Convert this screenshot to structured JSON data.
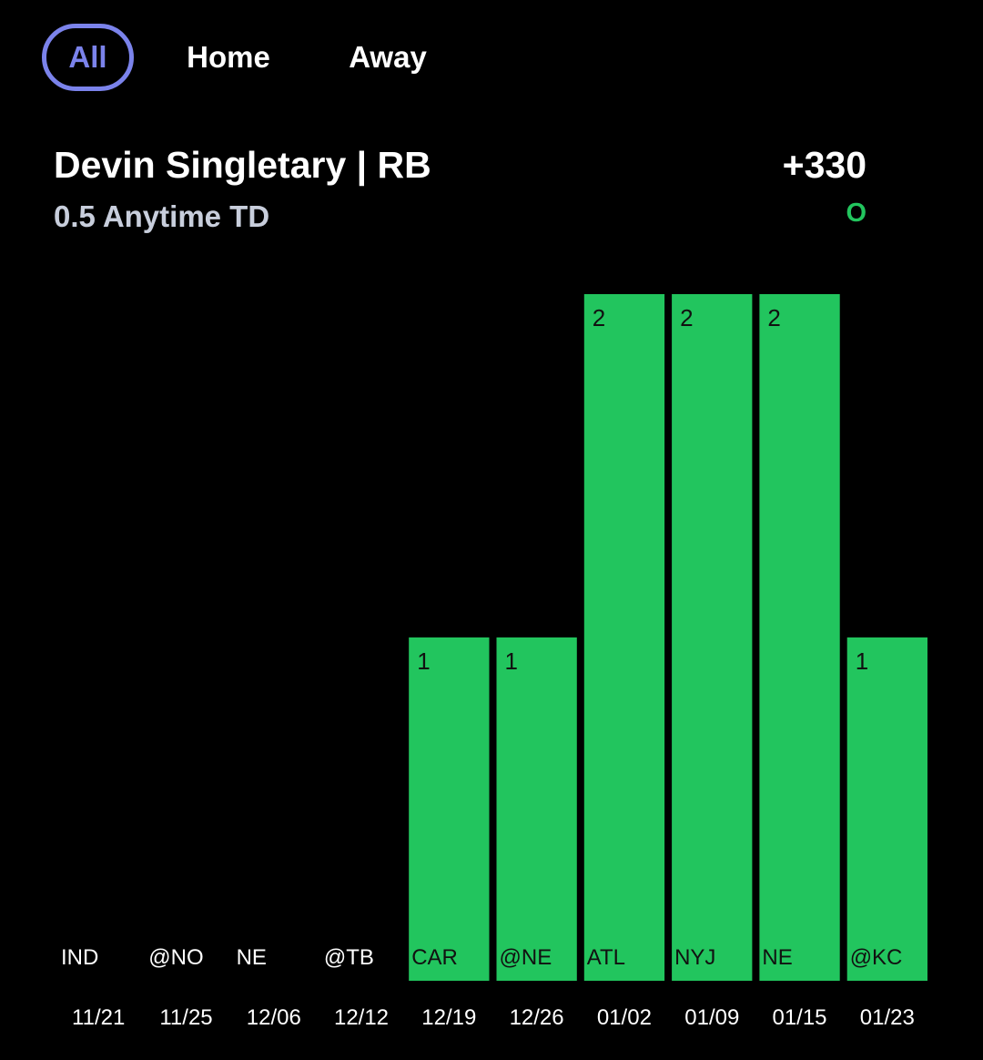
{
  "tabs": [
    {
      "label": "All",
      "active": true
    },
    {
      "label": "Home",
      "active": false
    },
    {
      "label": "Away",
      "active": false
    }
  ],
  "header": {
    "player": "Devin Singletary | RB",
    "market": "0.5 Anytime TD",
    "odds": "+330",
    "side": "O"
  },
  "colors": {
    "accent": "#7b83eb",
    "bar": "#22c55e",
    "over": "#22c55e"
  },
  "chart_data": {
    "type": "bar",
    "categories": [
      "11/21",
      "11/25",
      "12/06",
      "12/12",
      "12/19",
      "12/26",
      "01/02",
      "01/09",
      "01/15",
      "01/23"
    ],
    "opponents": [
      "IND",
      "@NO",
      "NE",
      "@TB",
      "CAR",
      "@NE",
      "ATL",
      "NYJ",
      "NE",
      "@KC"
    ],
    "values": [
      0,
      0,
      0,
      0,
      1,
      1,
      2,
      2,
      2,
      1
    ],
    "ylim": [
      0,
      2
    ],
    "grid": false,
    "legend": "none"
  }
}
